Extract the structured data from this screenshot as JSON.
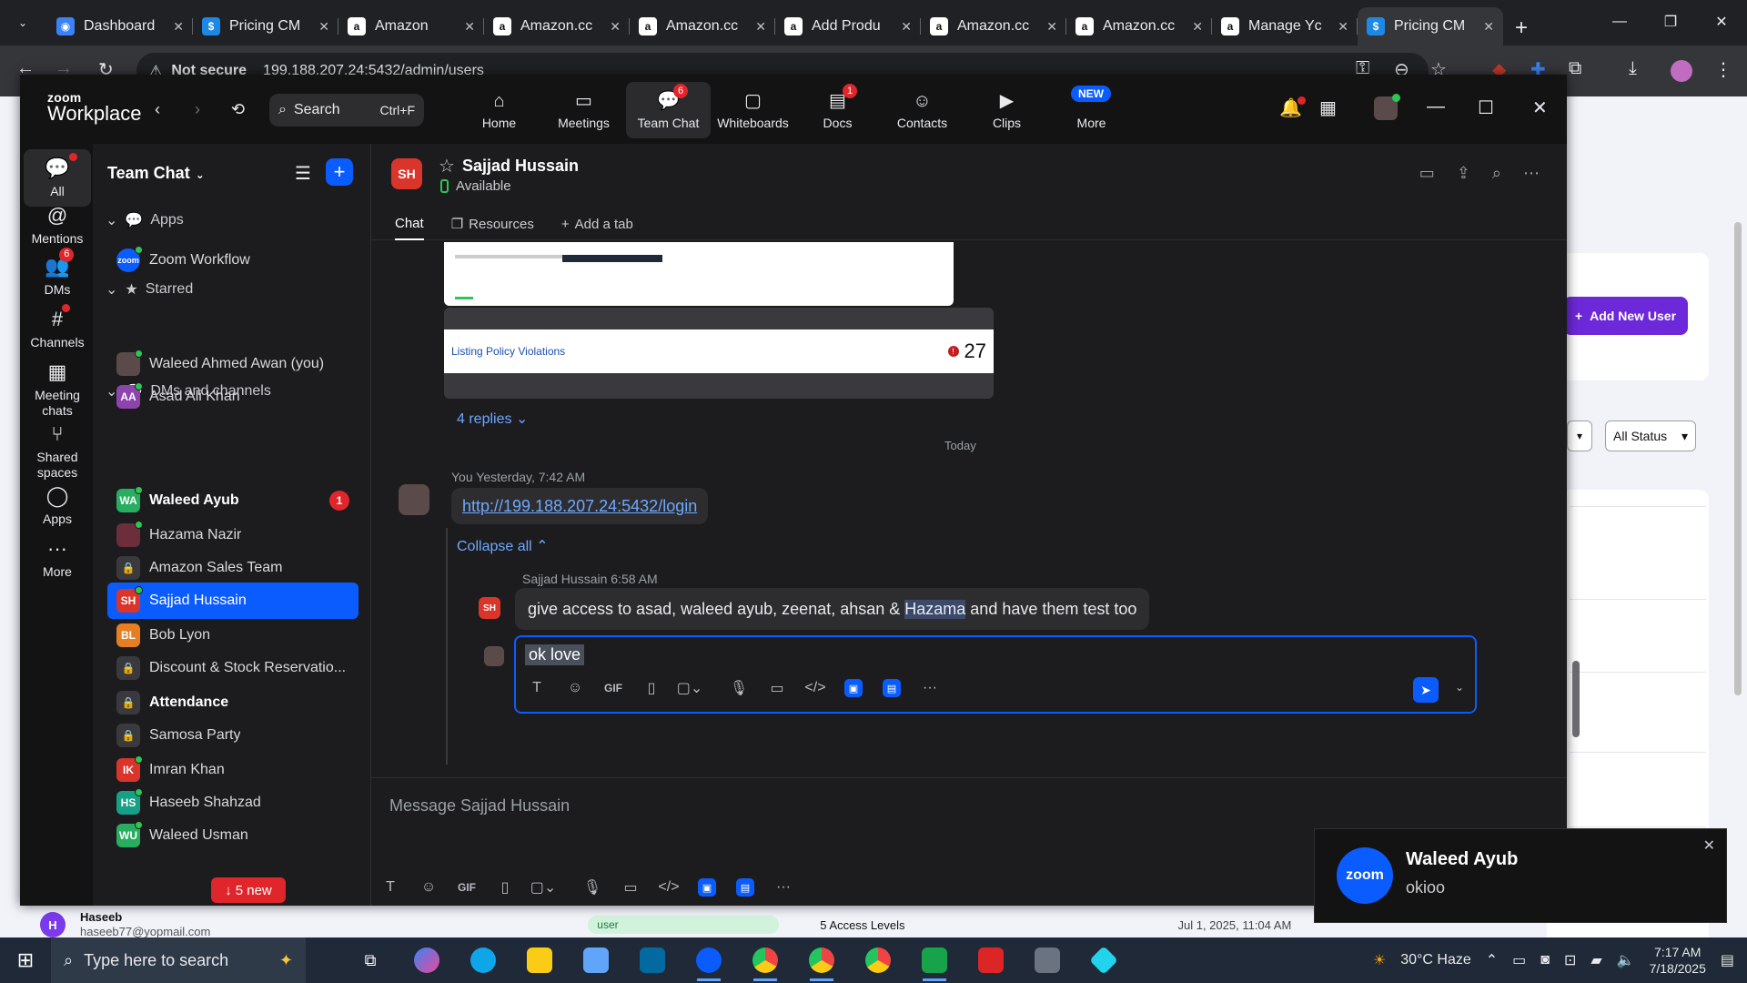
{
  "browser": {
    "tabs": [
      {
        "title": "Dashboard",
        "icon": "globe",
        "color": "#3b82f6"
      },
      {
        "title": "Pricing CM",
        "icon": "S",
        "color": "#1e88e5"
      },
      {
        "title": "Amazon",
        "icon": "a",
        "color": "#ffffff"
      },
      {
        "title": "Amazon.cc",
        "icon": "a",
        "color": "#ffffff"
      },
      {
        "title": "Amazon.cc",
        "icon": "a",
        "color": "#ffffff"
      },
      {
        "title": "Add Produ",
        "icon": "a",
        "color": "#ffffff"
      },
      {
        "title": "Amazon.cc",
        "icon": "a",
        "color": "#ffffff"
      },
      {
        "title": "Amazon.cc",
        "icon": "a",
        "color": "#ffffff"
      },
      {
        "title": "Manage Yc",
        "icon": "a",
        "color": "#ffffff"
      },
      {
        "title": "Pricing CM",
        "icon": "S",
        "color": "#1e88e5",
        "active": true
      }
    ],
    "security_label": "Not secure",
    "url": "199.188.207.24:5432/admin/users"
  },
  "webpage": {
    "add_user_label": "Add New User",
    "status_select": "All Status",
    "row_name": "Haseeb",
    "row_email": "haseeb77@yopmail.com",
    "row_role": "user",
    "row_access": "5 Access Levels",
    "row_date": "Jul 1, 2025, 11:04 AM"
  },
  "zoom": {
    "logo_top": "zoom",
    "logo_bottom": "Workplace",
    "search_label": "Search",
    "search_shortcut": "Ctrl+F",
    "nav": [
      {
        "label": "Home",
        "icon": "⌂"
      },
      {
        "label": "Meetings",
        "icon": "▭"
      },
      {
        "label": "Team Chat",
        "icon": "💬",
        "badge": "6",
        "active": true
      },
      {
        "label": "Whiteboards",
        "icon": "▢"
      },
      {
        "label": "Docs",
        "icon": "▤",
        "badge": "1"
      },
      {
        "label": "Contacts",
        "icon": "☺"
      },
      {
        "label": "Clips",
        "icon": "▶"
      },
      {
        "label": "More",
        "icon": "⋯",
        "badge_new": "NEW"
      }
    ],
    "rail": [
      {
        "label": "All",
        "icon": "💬"
      },
      {
        "label": "Mentions",
        "icon": "@"
      },
      {
        "label": "DMs",
        "icon": "👥",
        "badge": "6"
      },
      {
        "label": "Channels",
        "icon": "#"
      },
      {
        "label": "Meeting chats",
        "icon": "▦"
      },
      {
        "label": "Shared spaces",
        "icon": "⑂"
      },
      {
        "label": "Apps",
        "icon": "◯"
      },
      {
        "label": "More",
        "icon": "···"
      }
    ],
    "list_title": "Team Chat",
    "sections": {
      "apps": "Apps",
      "starred": "Starred",
      "dms": "DMs and channels"
    },
    "items": [
      {
        "name": "Zoom Workflow",
        "avatar": "zoom",
        "color": "#0b5cff"
      },
      {
        "name": "Waleed Ahmed Awan (you)",
        "avatar": "",
        "color": "#5a4a4a"
      },
      {
        "name": "Asad Ali Khan",
        "avatar": "AA",
        "color": "#8e44ad"
      },
      {
        "name": "Waleed Ayub",
        "avatar": "WA",
        "color": "#27ae60",
        "count": "1",
        "bold": true
      },
      {
        "name": "Hazama Nazir",
        "avatar": "",
        "color": "#6b2e3a"
      },
      {
        "name": "Amazon Sales Team",
        "avatar": "🔒",
        "color": "#3a3a3e"
      },
      {
        "name": "Sajjad Hussain",
        "avatar": "SH",
        "color": "#d9352b",
        "selected": true
      },
      {
        "name": "Bob Lyon",
        "avatar": "BL",
        "color": "#e67e22"
      },
      {
        "name": "Discount & Stock Reservatio...",
        "avatar": "🔒",
        "color": "#3a3a3e"
      },
      {
        "name": "Attendance",
        "avatar": "🔒",
        "color": "#3a3a3e",
        "bold": true
      },
      {
        "name": "Samosa Party",
        "avatar": "🔒",
        "color": "#3a3a3e"
      },
      {
        "name": "Imran Khan",
        "avatar": "IK",
        "color": "#d9352b"
      },
      {
        "name": "Haseeb Shahzad",
        "avatar": "HS",
        "color": "#16a085"
      },
      {
        "name": "Waleed Usman",
        "avatar": "WU",
        "color": "#27ae60"
      }
    ],
    "new_pill": "5 new",
    "chat": {
      "contact_name": "Sajjad Hussain",
      "contact_initials": "SH",
      "status": "Available",
      "tabs": [
        "Chat",
        "Resources",
        "Add a tab"
      ],
      "card_label": "Listing Policy Violations",
      "card_value": "27",
      "replies": "4 replies",
      "day_divider": "Today",
      "my_meta": "You Yesterday, 7:42 AM",
      "my_link": "http://199.188.207.24:5432/login",
      "collapse": "Collapse all",
      "reply_meta": "Sajjad Hussain 6:58 AM",
      "reply_text_a": "give access to asad, waleed ayub, zeenat, ahsan & ",
      "reply_text_hl": "Hazama",
      "reply_text_b": " and have them test too",
      "draft": "ok love",
      "composer_placeholder": "Message Sajjad Hussain"
    },
    "toast": {
      "brand": "zoom",
      "name": "Waleed Ayub",
      "message": "okioo"
    }
  },
  "taskbar": {
    "search_placeholder": "Type here to search",
    "weather": "30°C Haze",
    "time": "7:17 AM",
    "date": "7/18/2025"
  }
}
